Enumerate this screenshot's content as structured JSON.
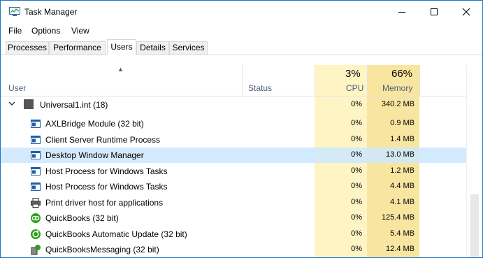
{
  "window": {
    "title": "Task Manager"
  },
  "menu": [
    "File",
    "Options",
    "View"
  ],
  "tabs": [
    "Processes",
    "Performance",
    "Users",
    "Details",
    "Services"
  ],
  "active_tab": "Users",
  "columns": {
    "user": "User",
    "status": "Status",
    "cpu": {
      "label": "CPU",
      "percent": "3%"
    },
    "memory": {
      "label": "Memory",
      "percent": "66%"
    }
  },
  "group": {
    "name": "Universal1.int (18)",
    "cpu": "0%",
    "memory": "340.2 MB",
    "expanded": true
  },
  "processes": [
    {
      "name": "AXLBridge Module (32 bit)",
      "cpu": "0%",
      "memory": "0.9 MB",
      "icon": "app-window-icon"
    },
    {
      "name": "Client Server Runtime Process",
      "cpu": "0%",
      "memory": "1.4 MB",
      "icon": "app-window-icon"
    },
    {
      "name": "Desktop Window Manager",
      "cpu": "0%",
      "memory": "13.0 MB",
      "icon": "app-window-icon",
      "selected": true
    },
    {
      "name": "Host Process for Windows Tasks",
      "cpu": "0%",
      "memory": "1.2 MB",
      "icon": "app-window-icon"
    },
    {
      "name": "Host Process for Windows Tasks",
      "cpu": "0%",
      "memory": "4.4 MB",
      "icon": "app-window-icon"
    },
    {
      "name": "Print driver host for applications",
      "cpu": "0%",
      "memory": "4.1 MB",
      "icon": "printer-icon"
    },
    {
      "name": "QuickBooks (32 bit)",
      "cpu": "0%",
      "memory": "125.4 MB",
      "icon": "quickbooks-icon"
    },
    {
      "name": "QuickBooks Automatic Update (32 bit)",
      "cpu": "0%",
      "memory": "5.4 MB",
      "icon": "quickbooks-update-icon"
    },
    {
      "name": "QuickBooksMessaging (32 bit)",
      "cpu": "0%",
      "memory": "12.4 MB",
      "icon": "quickbooks-messaging-icon"
    }
  ],
  "colors": {
    "accent_border": "#1e73c4",
    "selected_row": "#cce8ff",
    "cpu_column": "#fff4c4",
    "memory_column": "#f8e6a0",
    "header_text": "#4c607a"
  }
}
